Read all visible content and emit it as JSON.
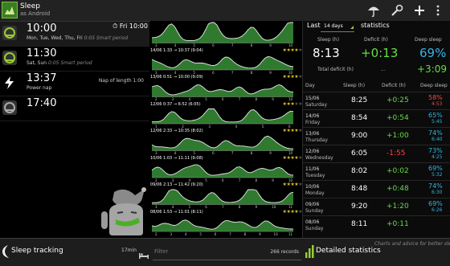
{
  "app": {
    "title": "Sleep",
    "subtitle": "as Android"
  },
  "alarms": [
    {
      "time": "10:00",
      "days": "Mon, Tue, Wed, Thu, Fri",
      "note": "0:05 Smart period",
      "right": "Fri 10:00"
    },
    {
      "time": "11:30",
      "days": "Sat, Sun",
      "note": "0:05 Smart period",
      "right": ""
    },
    {
      "time": "13:37",
      "days": "Power nap",
      "note": "",
      "right": "Nap of length 1:00"
    },
    {
      "time": "17:40",
      "days": "",
      "note": "",
      "right": ""
    }
  ],
  "graphs": [
    {
      "label": "",
      "stars": 0,
      "axis": [
        "3",
        "4",
        "5",
        "6",
        "7",
        "8",
        "9",
        "10"
      ]
    },
    {
      "label": "14/06 1:33 → 10:37 (9:04)",
      "stars": 4,
      "axis": [
        "3",
        "4",
        "5",
        "6",
        "7",
        "8",
        "9",
        "10"
      ]
    },
    {
      "label": "13/06 0:51 → 10:00 (9:09)",
      "stars": 4,
      "axis": [
        "2",
        "3",
        "4",
        "5",
        "6",
        "7",
        "8",
        "9",
        "10"
      ]
    },
    {
      "label": "12/06 0:37 → 6:52 (6:05)",
      "stars": 3,
      "axis": [
        "1",
        "2",
        "3",
        "4",
        "5",
        "6"
      ]
    },
    {
      "label": "12/06 2:33 → 10:35 (8:02)",
      "stars": 4,
      "axis": [
        "3",
        "4",
        "5",
        "6",
        "7",
        "8",
        "9",
        "10"
      ]
    },
    {
      "label": "10/06 1:03 → 11:11 (9:08)",
      "stars": 4,
      "axis": [
        "2",
        "3",
        "4",
        "5",
        "6",
        "7",
        "8",
        "9",
        "10"
      ]
    },
    {
      "label": "09/06 2:13 → 11:42 (9:20)",
      "stars": 4,
      "axis": [
        "3",
        "4",
        "5",
        "6",
        "7",
        "8",
        "9",
        "10",
        "11"
      ]
    },
    {
      "label": "08/06 1:53 → 11:01 (8:11)",
      "stars": 4,
      "axis": [
        "2",
        "3",
        "4",
        "5",
        "6",
        "7",
        "8",
        "9",
        "10",
        "11"
      ]
    }
  ],
  "stats": {
    "header_label": "Last",
    "period": "14 days",
    "header_title": "statistics",
    "sleep_label": "Sleep (h)",
    "sleep_value": "8:13",
    "deficit_label": "Deficit (h)",
    "deficit_value": "+0:13",
    "deep_label": "Deep sleep",
    "deep_value": "69%",
    "total_deficit_label": "Total deficit (h)",
    "total_deficit_mid": "...",
    "total_deficit_value": "+3:09",
    "columns": [
      "Day",
      "Sleep (h)",
      "Deficit (h)",
      "Deep sleep"
    ],
    "rows": [
      {
        "date": "15/06",
        "weekday": "Saturday",
        "sleep": "8:25",
        "deficit": "+0:25",
        "deep": "58%",
        "deep_time": "4:53"
      },
      {
        "date": "14/06",
        "weekday": "Friday",
        "sleep": "8:54",
        "deficit": "+0:54",
        "deep": "65%",
        "deep_time": "5:45"
      },
      {
        "date": "13/06",
        "weekday": "Thursday",
        "sleep": "9:00",
        "deficit": "+1:00",
        "deep": "74%",
        "deep_time": "6:40"
      },
      {
        "date": "12/06",
        "weekday": "Wednesday",
        "sleep": "6:05",
        "deficit": "-1:55",
        "deep": "73%",
        "deep_time": "4:25"
      },
      {
        "date": "11/06",
        "weekday": "Tuesday",
        "sleep": "8:02",
        "deficit": "+0:02",
        "deep": "69%",
        "deep_time": "5:32"
      },
      {
        "date": "10/06",
        "weekday": "Monday",
        "sleep": "8:48",
        "deficit": "+0:48",
        "deep": "74%",
        "deep_time": "6:30"
      },
      {
        "date": "09/06",
        "weekday": "Sunday",
        "sleep": "9:20",
        "deficit": "+1:20",
        "deep": "69%",
        "deep_time": "6:26"
      },
      {
        "date": "08/06",
        "weekday": "Sunday",
        "sleep": "8:11",
        "deficit": "+0:11",
        "deep": "",
        "deep_time": ""
      }
    ]
  },
  "bottom": {
    "sleep_tracking": "Sleep tracking",
    "tracking_time": "17min",
    "filter_placeholder": "Filter",
    "records": "266 records",
    "detailed": "Detailed statistics",
    "advice": "Charts and advice for better sleep"
  },
  "colors": {
    "accent_green": "#99cc33",
    "deficit_green": "#66dd44",
    "deficit_red": "#ff4444",
    "deep_blue": "#33b5e5",
    "star": "#d9c02a"
  }
}
